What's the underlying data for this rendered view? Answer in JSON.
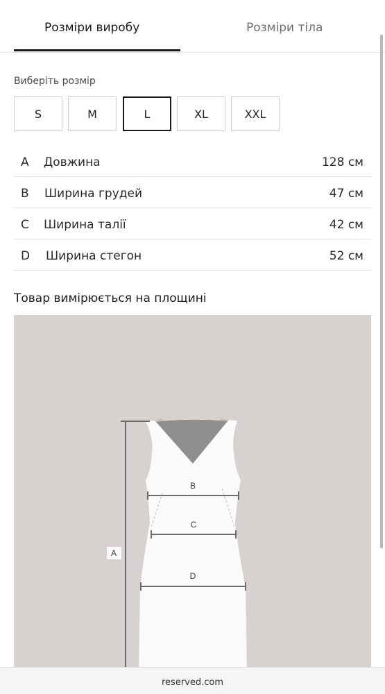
{
  "tabs": {
    "product_sizes": "Розміри виробу",
    "body_sizes": "Розміри тіла"
  },
  "size_picker": {
    "label": "Виберіть розмір",
    "options": [
      "S",
      "M",
      "L",
      "XL",
      "XXL"
    ],
    "selected": "L"
  },
  "measurements": [
    {
      "letter": "A",
      "name": "Довжина",
      "value": "128 см"
    },
    {
      "letter": "B",
      "name": "Ширина грудей",
      "value": "47 см"
    },
    {
      "letter": "C",
      "name": "Ширина талії",
      "value": "42 см"
    },
    {
      "letter": "D",
      "name": "Ширина стегон",
      "value": "52 см"
    }
  ],
  "note": "Товар вимірюється на площині",
  "diagram_labels": {
    "a": "A",
    "b": "B",
    "c": "C",
    "d": "D"
  },
  "footer": {
    "domain": "reserved.com"
  },
  "colors": {
    "diagram_bg": "#d7d2cf",
    "dress": "#fafafa",
    "neckline": "#8f8f8f",
    "accent": "#1a1a1a"
  }
}
